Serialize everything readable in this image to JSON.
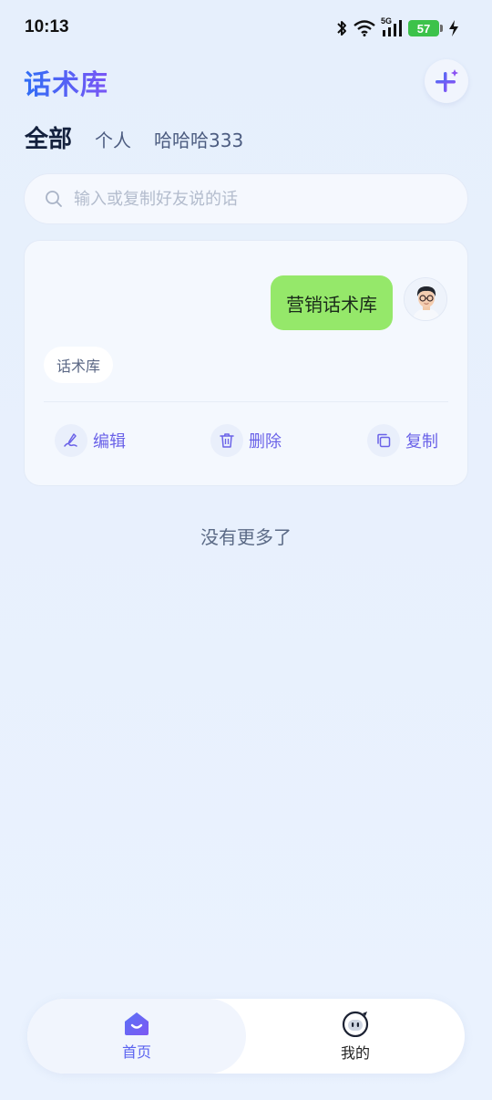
{
  "status_bar": {
    "time": "10:13",
    "network": "5G",
    "battery": "57",
    "icons": [
      "bluetooth-icon",
      "wifi-icon",
      "signal-icon",
      "battery-icon",
      "charging-icon"
    ]
  },
  "header": {
    "title": "话术库",
    "add_icon": "plus-sparkle-icon"
  },
  "tabs": [
    {
      "label": "全部",
      "active": true
    },
    {
      "label": "个人",
      "active": false
    },
    {
      "label": "哈哈哈333",
      "active": false
    }
  ],
  "search": {
    "placeholder": "输入或复制好友说的话",
    "value": ""
  },
  "card": {
    "message": "营销话术库",
    "tag": "话术库",
    "actions": {
      "edit": "编辑",
      "delete": "删除",
      "copy": "复制"
    }
  },
  "list_end_text": "没有更多了",
  "bottom_nav": {
    "home": "首页",
    "mine": "我的"
  },
  "colors": {
    "accent": "#5b63f0",
    "bubble": "#95e86a",
    "background": "#e8f1fd",
    "battery": "#3cc24a"
  }
}
